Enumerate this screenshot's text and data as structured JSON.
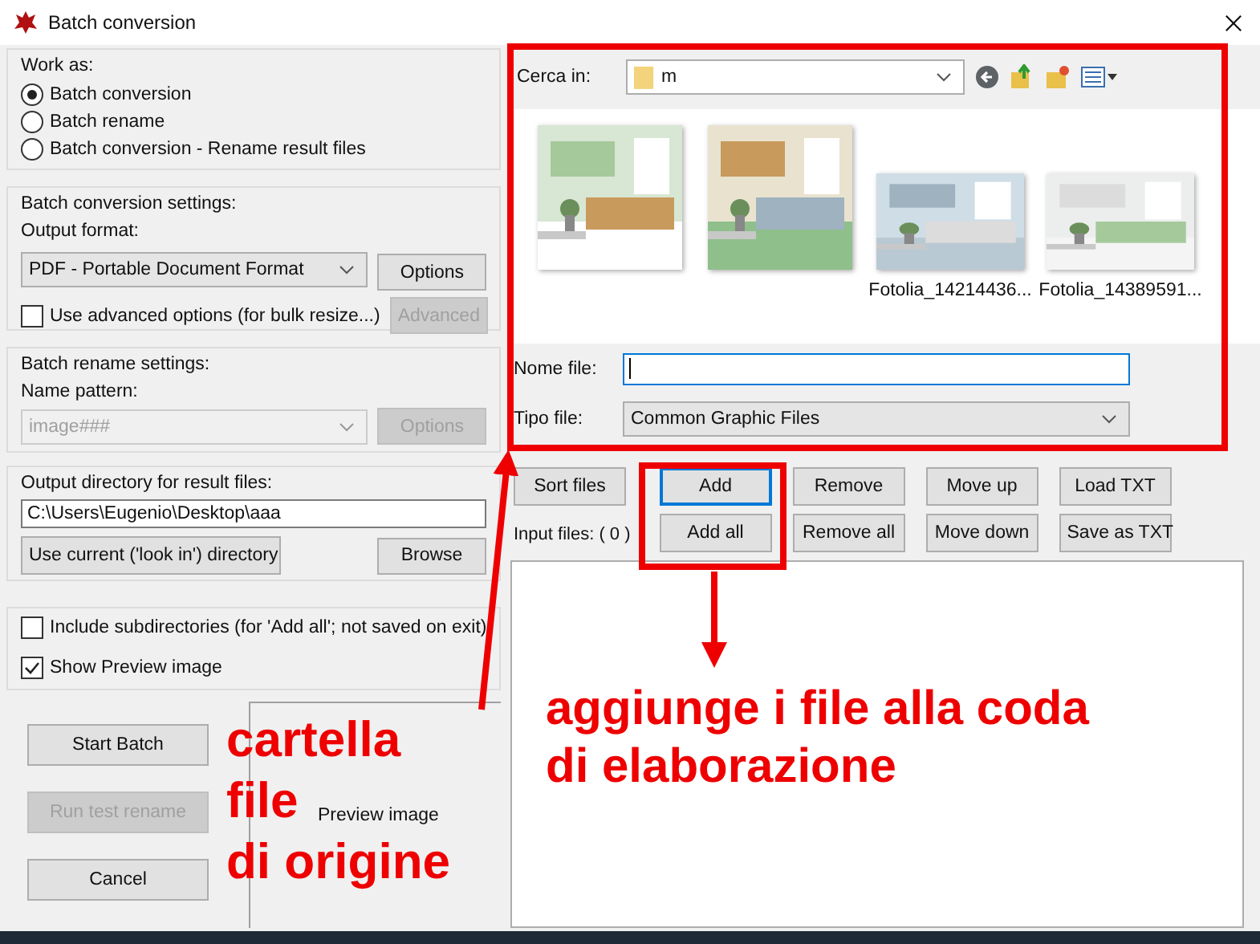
{
  "window": {
    "title": "Batch conversion"
  },
  "work_as": {
    "title": "Work as:",
    "options": [
      {
        "label": "Batch conversion",
        "selected": true
      },
      {
        "label": "Batch rename",
        "selected": false
      },
      {
        "label": "Batch conversion - Rename result files",
        "selected": false
      }
    ]
  },
  "conversion_settings": {
    "title": "Batch conversion settings:",
    "format_label": "Output format:",
    "format": "PDF - Portable Document Format",
    "options_button": {
      "label": "Options",
      "disabled": false
    },
    "advanced_checkbox": {
      "label": "Use advanced options (for bulk resize...)",
      "checked": false
    },
    "advanced_button": {
      "label": "Advanced",
      "disabled": true
    }
  },
  "rename_settings": {
    "title": "Batch rename settings:",
    "pattern_label": "Name pattern:",
    "pattern": "image###",
    "disabled": true,
    "options_button": {
      "label": "Options",
      "disabled": true
    }
  },
  "output_directory": {
    "title": "Output directory for result files:",
    "path": "C:\\Users\\Eugenio\\Desktop\\aaa",
    "use_current_button": "Use current ('look in') directory",
    "browse_button": "Browse"
  },
  "option_checks": [
    {
      "label": "Include subdirectories (for 'Add all'; not saved on exit)",
      "checked": false
    },
    {
      "label": "Show Preview image",
      "checked": true
    }
  ],
  "actions": [
    {
      "label": "Start Batch",
      "disabled": false
    },
    {
      "label": "Run test rename",
      "disabled": true
    },
    {
      "label": "Cancel",
      "disabled": false
    }
  ],
  "preview": {
    "label": "Preview image"
  },
  "file_browser": {
    "look_in_label": "Cerca in:",
    "folder": "m",
    "thumbnails": [
      {
        "kind": "picture"
      },
      {
        "kind": "picture"
      },
      {
        "kind": "picture",
        "caption": "Fotolia_14214436..."
      },
      {
        "kind": "picture",
        "caption": "Fotolia_14389591..."
      }
    ],
    "file_name_label": "Nome file:",
    "file_type_label": "Tipo file:",
    "file_type": "Common Graphic Files"
  },
  "list_buttons": [
    [
      {
        "label": "Sort files",
        "focused": false
      },
      {
        "label": "Add",
        "focused": true
      },
      {
        "label": "Remove",
        "focused": false
      },
      {
        "label": "Move up",
        "focused": false
      },
      {
        "label": "Load TXT",
        "focused": false
      }
    ],
    [
      {
        "label": "Add all",
        "focused": false
      },
      {
        "label": "Remove all",
        "focused": false
      },
      {
        "label": "Move down",
        "focused": false
      },
      {
        "label": "Save as TXT",
        "focused": false
      }
    ]
  ],
  "input_files_label": "Input files: ( 0 )",
  "annotations": {
    "source_note": [
      "cartella",
      "file",
      "di origine"
    ],
    "queue_note": "aggiunge i file alla coda\ndi elaborazione"
  }
}
